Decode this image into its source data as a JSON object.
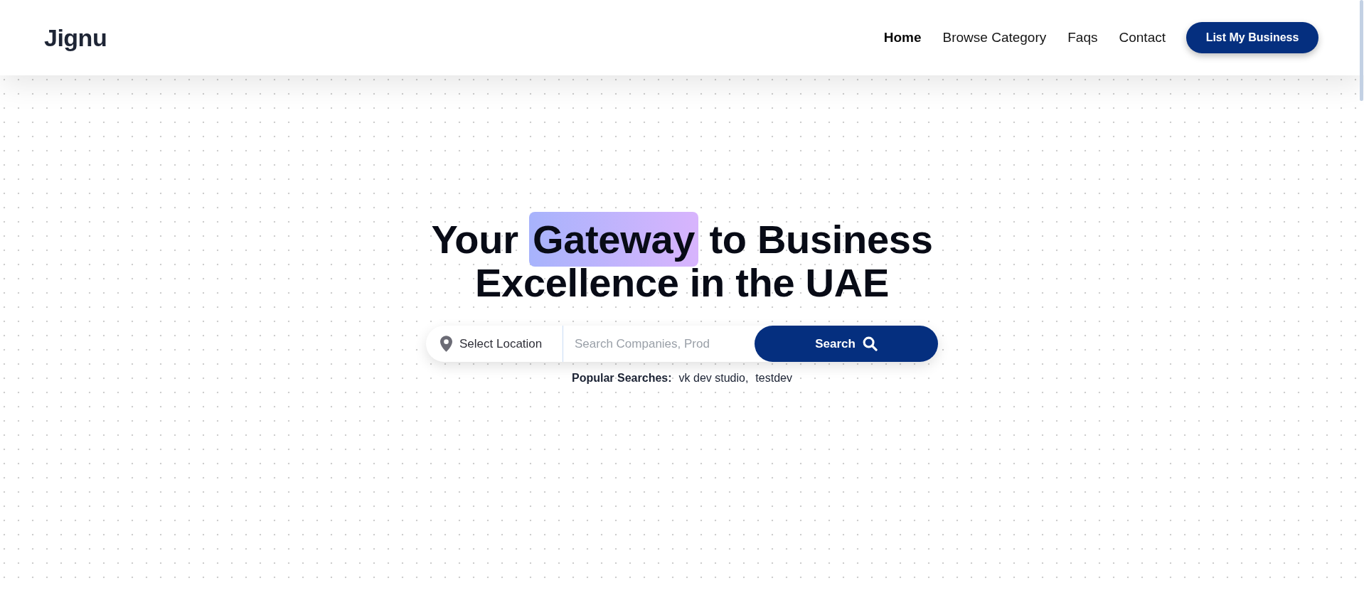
{
  "header": {
    "logo": "Jignu",
    "nav": [
      {
        "label": "Home",
        "selected": true
      },
      {
        "label": "Browse Category",
        "selected": false
      },
      {
        "label": "Faqs",
        "selected": false
      },
      {
        "label": "Contact",
        "selected": false
      }
    ],
    "cta": "List My Business"
  },
  "hero": {
    "title": {
      "before": "Your",
      "highlight": "Gateway",
      "after": "to Business Excellence in the UAE"
    },
    "search": {
      "location": "Select Location",
      "placeholder": "Search Companies, Prod",
      "button": "Search"
    },
    "popular": {
      "label": "Popular Searches:",
      "items": [
        "vk dev studio,",
        "testdev"
      ]
    }
  }
}
